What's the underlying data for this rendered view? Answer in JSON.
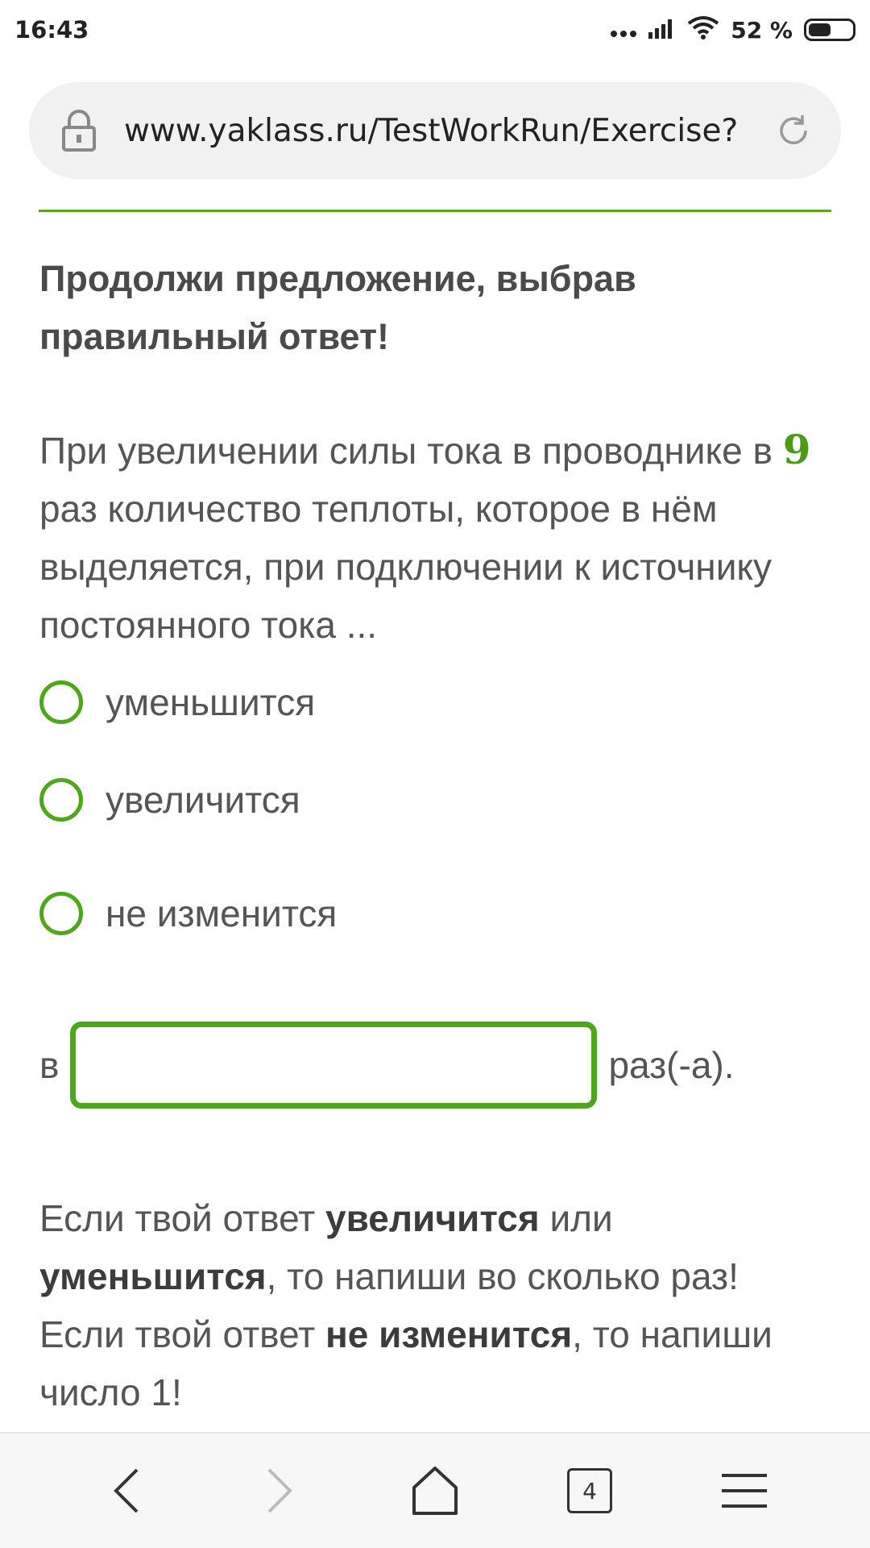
{
  "status_bar": {
    "time": "16:43",
    "battery_percent_text": "52 %",
    "battery_level": 0.52
  },
  "browser": {
    "url": "www.yaklass.ru/TestWorkRun/Exercise?",
    "tabs_count": "4"
  },
  "task": {
    "title": "Продолжи предложение, выбрав правильный ответ!",
    "question_part1": "При увеличении  силы тока в проводнике в ",
    "question_number": "9",
    "question_part2": " раз количество теплоты, которое в нём выделяется, при подключении к источнику постоянного тока ..."
  },
  "options": [
    {
      "label": "уменьшится"
    },
    {
      "label": "увеличится"
    },
    {
      "label": "не изменится"
    }
  ],
  "answer": {
    "prefix": "в",
    "value": "",
    "suffix": "раз(-а)."
  },
  "hint": {
    "p1": "Если твой ответ ",
    "b1": "увеличится",
    "p2": " или ",
    "b2": "уменьшится",
    "p3": ", то напиши во сколько раз! Если твой ответ ",
    "b3": "не изменится",
    "p4": ", то напиши число 1!"
  },
  "colors": {
    "accent_green": "#4ea61a"
  },
  "icons": {
    "lock": "lock-icon",
    "reload": "reload-icon",
    "back": "back-arrow-icon",
    "forward": "forward-arrow-icon",
    "home": "home-icon",
    "menu": "menu-icon"
  }
}
